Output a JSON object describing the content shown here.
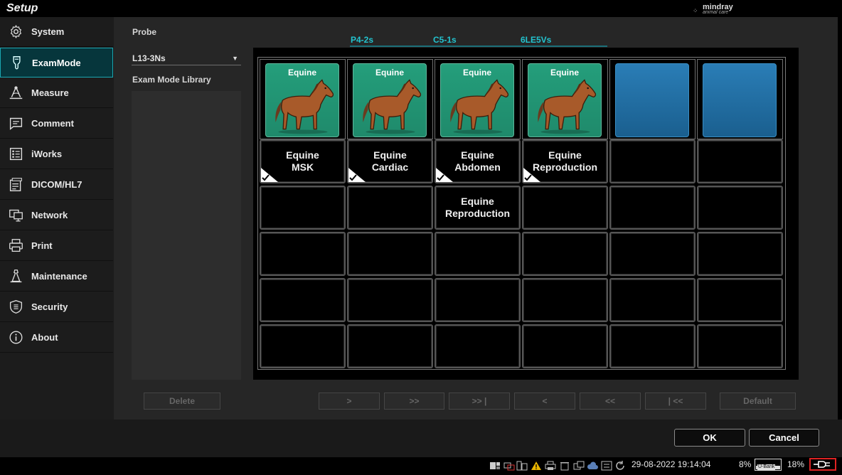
{
  "window": {
    "title": "Setup"
  },
  "brand": {
    "name": "mindray",
    "sub": "animal care"
  },
  "sidebar": {
    "items": [
      {
        "label": "System",
        "icon": "gear-icon"
      },
      {
        "label": "ExamMode",
        "icon": "probe-icon",
        "active": true
      },
      {
        "label": "Measure",
        "icon": "measure-icon"
      },
      {
        "label": "Comment",
        "icon": "comment-icon"
      },
      {
        "label": "iWorks",
        "icon": "iworks-icon"
      },
      {
        "label": "DICOM/HL7",
        "icon": "dicom-icon"
      },
      {
        "label": "Network",
        "icon": "network-icon"
      },
      {
        "label": "Print",
        "icon": "printer-icon"
      },
      {
        "label": "Maintenance",
        "icon": "maintenance-icon"
      },
      {
        "label": "Security",
        "icon": "shield-icon"
      },
      {
        "label": "About",
        "icon": "info-icon"
      }
    ]
  },
  "probe": {
    "label": "Probe",
    "selected": "L13-3Ns",
    "library_label": "Exam Mode Library",
    "tabs": [
      "P4-2s",
      "C5-1s",
      "6LE5Vs"
    ]
  },
  "grid": {
    "animals": [
      {
        "name": "Equine",
        "filled": true
      },
      {
        "name": "Equine",
        "filled": true
      },
      {
        "name": "Equine",
        "filled": true
      },
      {
        "name": "Equine",
        "filled": true
      },
      {
        "name": "",
        "filled": false
      },
      {
        "name": "",
        "filled": false
      }
    ],
    "rows": [
      [
        {
          "line1": "Equine",
          "line2": "MSK",
          "checked": true
        },
        {
          "line1": "Equine",
          "line2": "Cardiac",
          "checked": true
        },
        {
          "line1": "Equine",
          "line2": "Abdomen",
          "checked": true
        },
        {
          "line1": "Equine",
          "line2": "Reproduction",
          "checked": true
        },
        {
          "line1": "",
          "line2": "",
          "checked": false
        },
        {
          "line1": "",
          "line2": "",
          "checked": false
        }
      ],
      [
        {
          "line1": "",
          "line2": "",
          "checked": false
        },
        {
          "line1": "",
          "line2": "",
          "checked": false
        },
        {
          "line1": "Equine",
          "line2": "Reproduction",
          "checked": false
        },
        {
          "line1": "",
          "line2": "",
          "checked": false
        },
        {
          "line1": "",
          "line2": "",
          "checked": false
        },
        {
          "line1": "",
          "line2": "",
          "checked": false
        }
      ],
      [
        {
          "line1": "",
          "line2": "",
          "checked": false
        },
        {
          "line1": "",
          "line2": "",
          "checked": false
        },
        {
          "line1": "",
          "line2": "",
          "checked": false
        },
        {
          "line1": "",
          "line2": "",
          "checked": false
        },
        {
          "line1": "",
          "line2": "",
          "checked": false
        },
        {
          "line1": "",
          "line2": "",
          "checked": false
        }
      ],
      [
        {
          "line1": "",
          "line2": "",
          "checked": false
        },
        {
          "line1": "",
          "line2": "",
          "checked": false
        },
        {
          "line1": "",
          "line2": "",
          "checked": false
        },
        {
          "line1": "",
          "line2": "",
          "checked": false
        },
        {
          "line1": "",
          "line2": "",
          "checked": false
        },
        {
          "line1": "",
          "line2": "",
          "checked": false
        }
      ],
      [
        {
          "line1": "",
          "line2": "",
          "checked": false
        },
        {
          "line1": "",
          "line2": "",
          "checked": false
        },
        {
          "line1": "",
          "line2": "",
          "checked": false
        },
        {
          "line1": "",
          "line2": "",
          "checked": false
        },
        {
          "line1": "",
          "line2": "",
          "checked": false
        },
        {
          "line1": "",
          "line2": "",
          "checked": false
        }
      ]
    ]
  },
  "buttons": {
    "delete": "Delete",
    "next": ">",
    "next_page": ">>",
    "last": ">> |",
    "prev": "<",
    "prev_page": "<<",
    "first": "| <<",
    "default": "Default",
    "ok": "OK",
    "cancel": "Cancel"
  },
  "status": {
    "datetime": "29-08-2022 19:14:04",
    "ubank_percent": "8%",
    "ubank_label": "U-Bank",
    "battery_percent": "18%"
  },
  "colors": {
    "accent": "#23c3cf",
    "active_bg": "#06363c",
    "animal_tile": "#1f8a6b",
    "empty_tile": "#1a5f8f",
    "battery_warning": "#dd2222"
  }
}
